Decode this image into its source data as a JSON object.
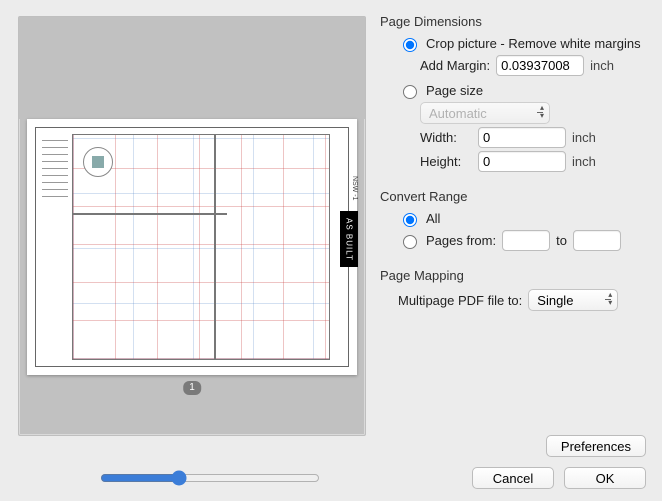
{
  "sections": {
    "page_dimensions": "Page Dimensions",
    "convert_range": "Convert Range",
    "page_mapping": "Page Mapping"
  },
  "crop": {
    "radio_label": "Crop picture - Remove white margins",
    "add_margin_label": "Add Margin:",
    "add_margin_value": "0.03937008",
    "unit": "inch",
    "selected": true
  },
  "page_size": {
    "radio_label": "Page size",
    "select_value": "Automatic",
    "width_label": "Width:",
    "width_value": "0",
    "height_label": "Height:",
    "height_value": "0",
    "unit": "inch",
    "selected": false
  },
  "range": {
    "all_label": "All",
    "all_selected": true,
    "pages_from_label": "Pages from:",
    "to_label": "to",
    "from_value": "",
    "to_value": ""
  },
  "mapping": {
    "label": "Multipage PDF file to:",
    "select_value": "Single"
  },
  "buttons": {
    "preferences": "Preferences",
    "cancel": "Cancel",
    "ok": "OK"
  },
  "preview": {
    "page_badge": "1",
    "side_label": "AS BUILT",
    "sub_label": "NSW -1"
  },
  "slider": {
    "value": 35,
    "min": 0,
    "max": 100
  }
}
